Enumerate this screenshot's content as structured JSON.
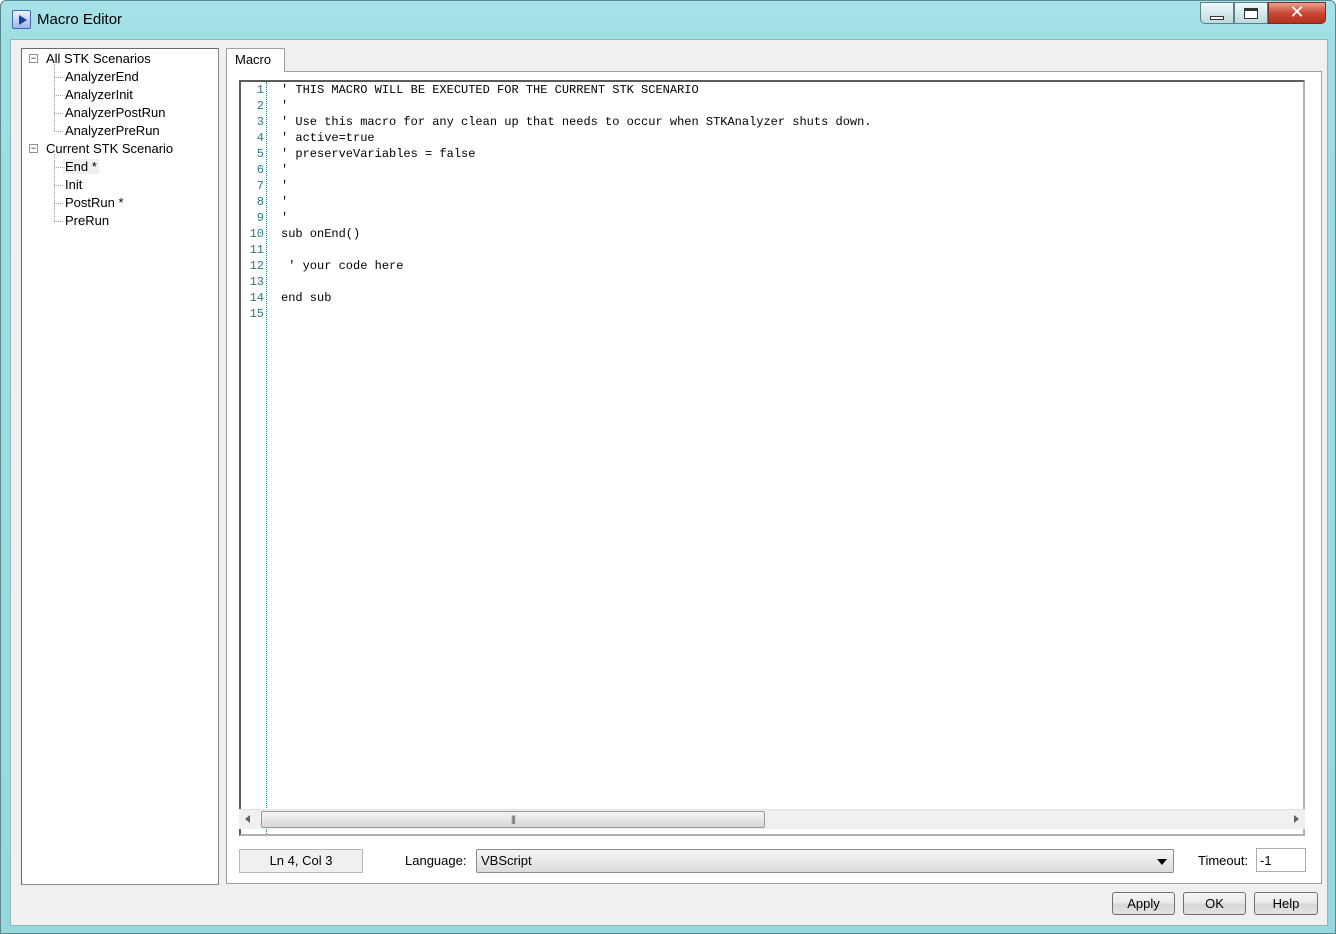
{
  "window": {
    "title": "Macro Editor",
    "minimize_icon": "minimize-icon",
    "maximize_icon": "maximize-icon",
    "close_icon": "close-icon",
    "close_glyph": "✕"
  },
  "tree": {
    "groups": [
      {
        "label": "All STK Scenarios",
        "expander": "⊟",
        "children": [
          "AnalyzerEnd",
          "AnalyzerInit",
          "AnalyzerPostRun",
          "AnalyzerPreRun"
        ]
      },
      {
        "label": "Current STK Scenario",
        "expander": "⊟",
        "children": [
          "End *",
          "Init",
          "PostRun *",
          "PreRun"
        ]
      }
    ],
    "selected": "End *"
  },
  "tabs": [
    {
      "label": "Macro",
      "active": true
    }
  ],
  "editor": {
    "line_numbers": [
      "1",
      "2",
      "3",
      "4",
      "5",
      "6",
      "7",
      "8",
      "9",
      "10",
      "11",
      "12",
      "13",
      "14",
      "15"
    ],
    "lines": [
      "' THIS MACRO WILL BE EXECUTED FOR THE CURRENT STK SCENARIO",
      "'",
      "' Use this macro for any clean up that needs to occur when STKAnalyzer shuts down.",
      "' active=true",
      "' preserveVariables = false",
      "'",
      "'",
      "'",
      "'",
      "sub onEnd()",
      "",
      " ' your code here",
      "",
      "end sub",
      ""
    ],
    "scroll_thumb_glyph": "|||"
  },
  "status": {
    "position": "Ln 4, Col 3",
    "language_label": "Language:",
    "language_value": "VBScript",
    "timeout_label": "Timeout:",
    "timeout_value": "-1"
  },
  "buttons": {
    "apply": "Apply",
    "ok": "OK",
    "help": "Help"
  },
  "colors": {
    "titlebar": "#a7e3e8",
    "line_number": "#2b7a8a",
    "close_button": "#c7442f"
  }
}
